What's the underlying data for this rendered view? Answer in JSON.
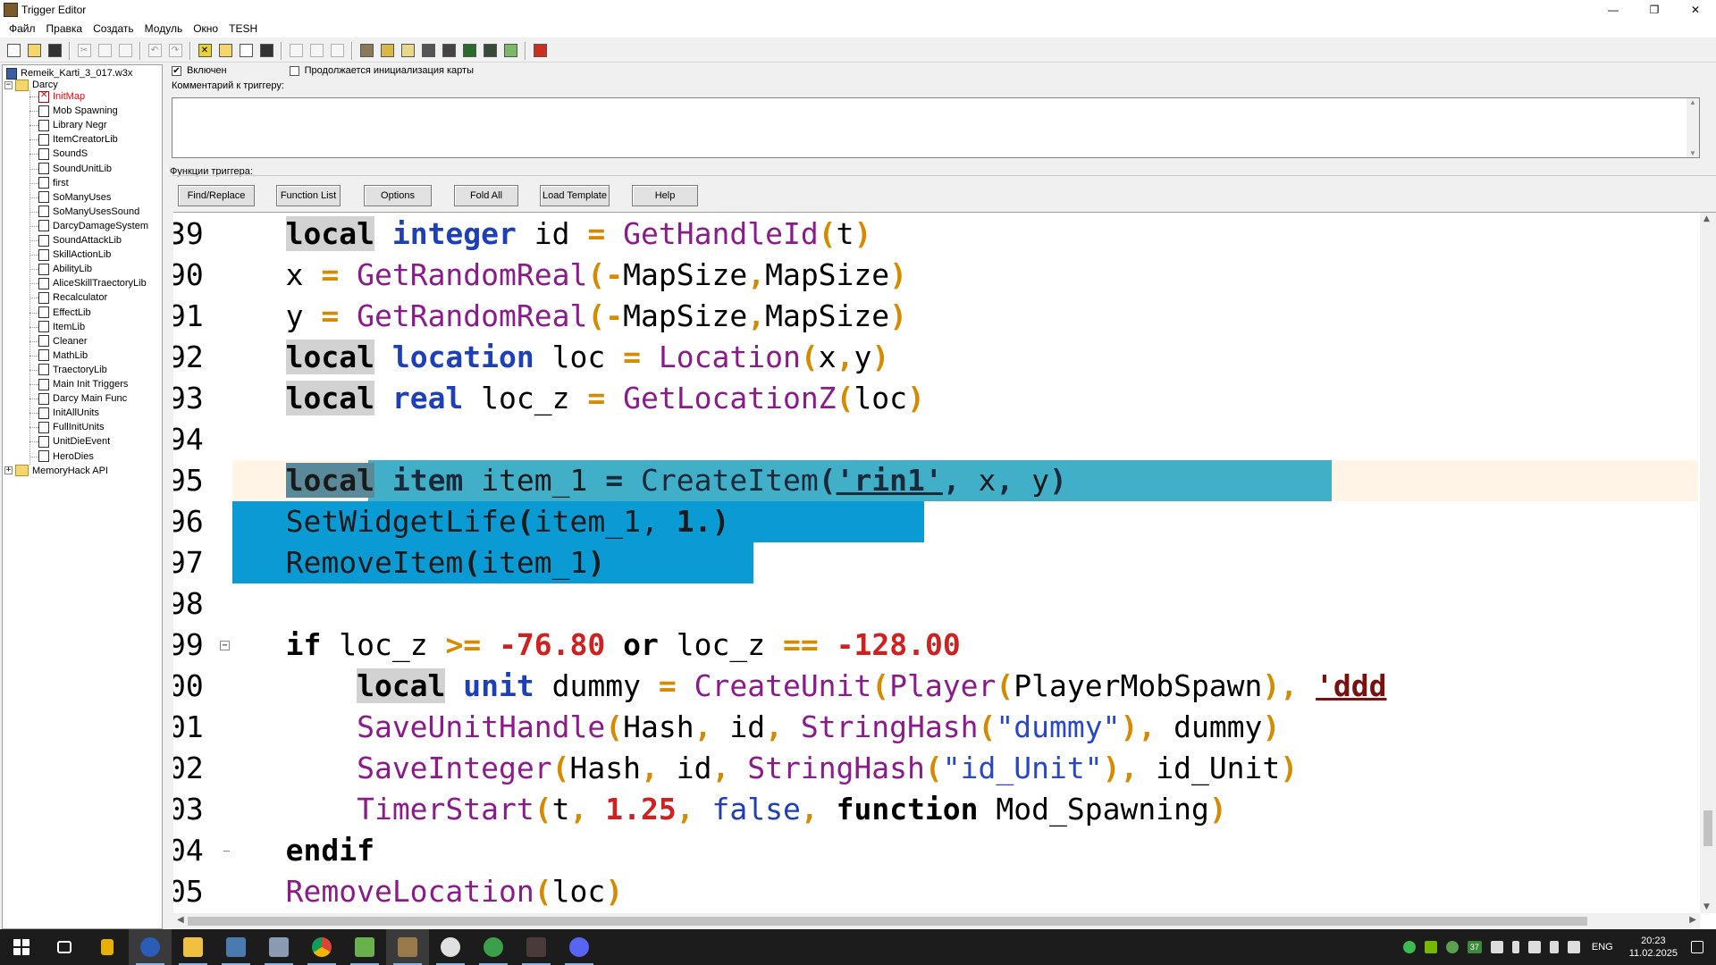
{
  "window": {
    "title": "Trigger Editor",
    "minimize": "—",
    "maximize": "❐",
    "close": "✕"
  },
  "menu": [
    "Файл",
    "Правка",
    "Создать",
    "Модуль",
    "Окно",
    "TESH"
  ],
  "tree": {
    "root": "Remeik_Karti_3_017.w3x",
    "folder": "Darcy",
    "items": [
      "InitMap",
      "Mob Spawning",
      "Library Negr",
      "ItemCreatorLib",
      "SoundS",
      "SoundUnitLib",
      "first",
      "SoManyUses",
      "SoManyUsesSound",
      "DarcyDamageSystem",
      "SoundAttackLib",
      "SkillActionLib",
      "AbilityLib",
      "AliceSkillTraectoryLib",
      "Recalculator",
      "EffectLib",
      "ItemLib",
      "Cleaner",
      "MathLib",
      "TraectoryLib",
      "Main Init Triggers",
      "Darcy Main Func",
      "InitAllUnits",
      "FullInitUnits",
      "UnitDieEvent",
      "HeroDies"
    ],
    "folder2": "MemoryHack API",
    "colors": {
      "selected_item": "#ff0000"
    }
  },
  "options": {
    "enabled_label": "Включен",
    "enabled_checked": true,
    "init_label": "Продолжается инициализация карты",
    "init_checked": false
  },
  "comment": {
    "label": "Комментарий к триггеру:",
    "value": ""
  },
  "functions": {
    "label": "Функции триггера:",
    "buttons": [
      "Find/Replace",
      "Function List",
      "Options",
      "Fold All",
      "Load Template",
      "Help"
    ]
  },
  "code": {
    "line_numbers": [
      "39",
      "90",
      "91",
      "92",
      "93",
      "94",
      "95",
      "96",
      "97",
      "98",
      "99",
      "00",
      "01",
      "02",
      "03",
      "04",
      "05"
    ]
  },
  "taskbar": {
    "clock_time": "20:23",
    "clock_date": "11.02.2025",
    "lang": "ENG",
    "badge": "37"
  }
}
